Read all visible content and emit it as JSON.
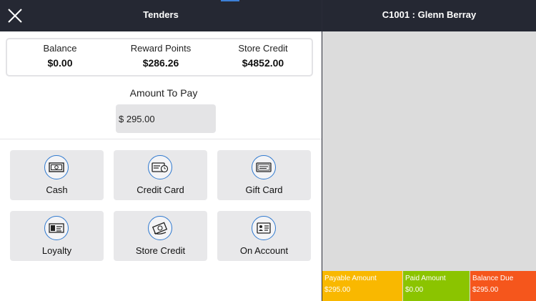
{
  "header": {
    "title": "Tenders"
  },
  "summary": {
    "balance": {
      "label": "Balance",
      "value": "$0.00"
    },
    "reward_points": {
      "label": "Reward Points",
      "value": "$286.26"
    },
    "store_credit": {
      "label": "Store Credit",
      "value": "$4852.00"
    }
  },
  "amount": {
    "label": "Amount To Pay",
    "value": "$ 295.00"
  },
  "tenders": [
    {
      "label": "Cash",
      "icon": "cash-icon"
    },
    {
      "label": "Credit Card",
      "icon": "credit-card-icon"
    },
    {
      "label": "Gift Card",
      "icon": "gift-card-icon"
    },
    {
      "label": "Loyalty",
      "icon": "loyalty-card-icon"
    },
    {
      "label": "Store Credit",
      "icon": "store-credit-icon"
    },
    {
      "label": "On Account",
      "icon": "account-card-icon"
    }
  ],
  "customer": {
    "title": "C1001 : Glenn Berray"
  },
  "footer": {
    "payable": {
      "label": "Payable Amount",
      "value": "$295.00",
      "color": "#f9b800"
    },
    "paid": {
      "label": "Paid Amount",
      "value": "$0.00",
      "color": "#8bc400"
    },
    "balance_due": {
      "label": "Balance Due",
      "value": "$295.00",
      "color": "#f5561c"
    }
  },
  "colors": {
    "header_bg": "#252833",
    "icon_accent": "#2f79cf"
  }
}
